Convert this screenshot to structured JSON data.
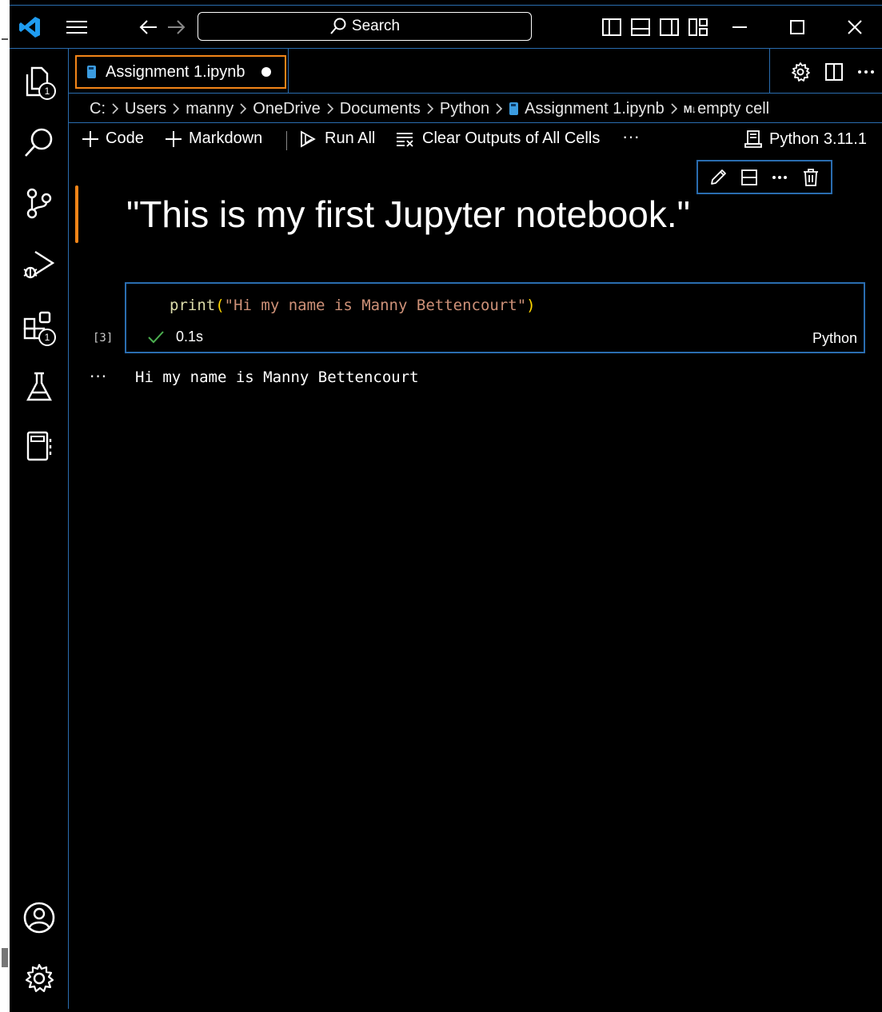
{
  "search": {
    "label": "Search"
  },
  "tab": {
    "title": "Assignment 1.ipynb"
  },
  "activity": {
    "explorer_badge": "1",
    "extensions_badge": "1"
  },
  "breadcrumb": {
    "items": [
      "C:",
      "Users",
      "manny",
      "OneDrive",
      "Documents",
      "Python",
      "Assignment 1.ipynb"
    ],
    "md_badge": "M↓",
    "last": "empty cell"
  },
  "toolbar": {
    "code": "Code",
    "markdown": "Markdown",
    "run_all": "Run All",
    "clear_outputs": "Clear Outputs of All Cells",
    "more": "···",
    "kernel": "Python 3.11.1"
  },
  "cells": {
    "markdown_heading": "\"This is my first Jupyter notebook.\"",
    "code": {
      "fn": "print",
      "open": "(",
      "string": "\"Hi my name is Manny Bettencourt\"",
      "close": ")",
      "exec_count": "[3]",
      "duration": "0.1s",
      "language": "Python"
    },
    "output_more": "···",
    "output": "Hi my name is Manny Bettencourt"
  },
  "colors": {
    "accent_blue": "#2a6db0",
    "focus_orange": "#f38518",
    "string": "#ce9178",
    "function": "#dcdcaa"
  }
}
